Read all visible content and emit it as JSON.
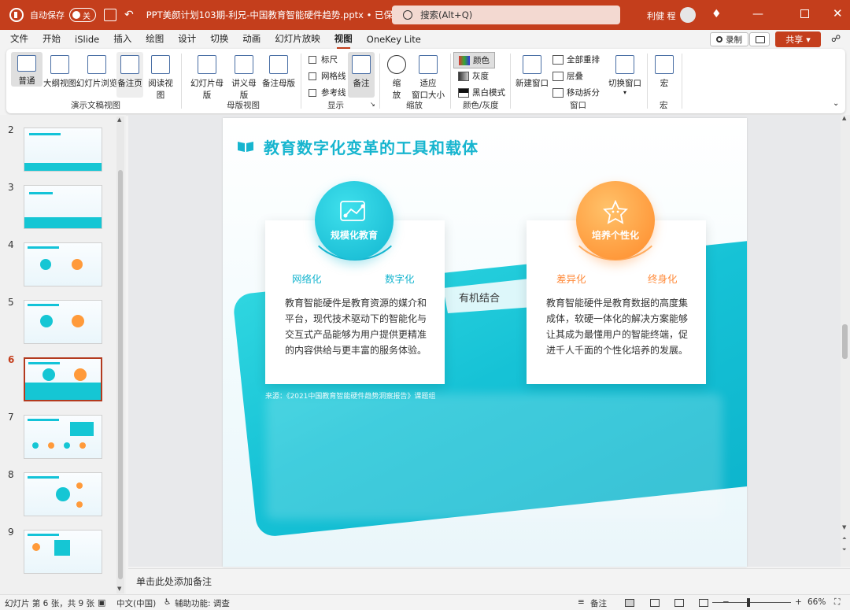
{
  "titlebar": {
    "autosave_label": "自动保存",
    "autosave_state": "关",
    "doc_title": "PPT美颜计划103期-利兄-中国教育智能硬件趋势.pptx • 已保存到这台电脑",
    "search_placeholder": "搜索(Alt+Q)",
    "user_name": "利健 程"
  },
  "tabs": [
    "文件",
    "开始",
    "iSlide",
    "插入",
    "绘图",
    "设计",
    "切换",
    "动画",
    "幻灯片放映",
    "视图",
    "OneKey Lite"
  ],
  "active_tab": "视图",
  "top_actions": {
    "record": "录制",
    "share": "共享"
  },
  "ribbon": {
    "presentation_views": {
      "normal": "普通",
      "outline": "大纲视图",
      "sorter": "幻灯片浏览",
      "notes_page": "备注页",
      "reading": "阅读视图",
      "group": "演示文稿视图"
    },
    "master_views": {
      "slide_master": "幻灯片母版",
      "handout_master": "讲义母版",
      "notes_master": "备注母版",
      "group": "母版视图"
    },
    "show": {
      "ruler": "标尺",
      "gridlines": "网格线",
      "guides": "参考线",
      "notes": "备注",
      "group": "显示"
    },
    "zoom": {
      "zoom_line1": "缩",
      "zoom_line2": "放",
      "fit_line1": "适应",
      "fit_line2": "窗口大小",
      "group": "缩放"
    },
    "color": {
      "color": "颜色",
      "grayscale": "灰度",
      "bw": "黑白模式",
      "group": "颜色/灰度"
    },
    "window": {
      "new": "新建窗口",
      "arrange": "全部重排",
      "cascade": "层叠",
      "move_split": "移动拆分",
      "switch": "切换窗口",
      "group": "窗口"
    },
    "macros": {
      "macro": "宏",
      "group": "宏"
    }
  },
  "thumbnails": [
    "2",
    "3",
    "4",
    "5",
    "6",
    "7",
    "8",
    "9"
  ],
  "current_slide_index": "6",
  "slide": {
    "title": "教育数字化变革的工具和载体",
    "left": {
      "circle_label": "规模化教育",
      "tag_left": "网络化",
      "tag_right": "数字化",
      "body": "教育智能硬件是教育资源的媒介和平台，现代技术驱动下的智能化与交互式产品能够为用户提供更精准的内容供给与更丰富的服务体验。"
    },
    "right": {
      "circle_label": "培养个性化",
      "tag_left": "差异化",
      "tag_right": "终身化",
      "body": "教育智能硬件是教育数据的高度集成体，软硬一体化的解决方案能够让其成为最懂用户的智能终端，促进千人千面的个性化培养的发展。"
    },
    "connector": "有机结合",
    "source": "来源：《2021中国教育智能硬件趋势洞察报告》课题组"
  },
  "notes_placeholder": "单击此处添加备注",
  "statusbar": {
    "slide_info": "幻灯片 第 6 张，共 9 张",
    "language": "中文(中国)",
    "accessibility": "辅助功能: 调查",
    "notes_btn": "备注",
    "zoom_percent": "66%"
  },
  "colors": {
    "brand": "#c43e1c",
    "teal": "#17b5cf",
    "orange": "#ff9a3a"
  }
}
